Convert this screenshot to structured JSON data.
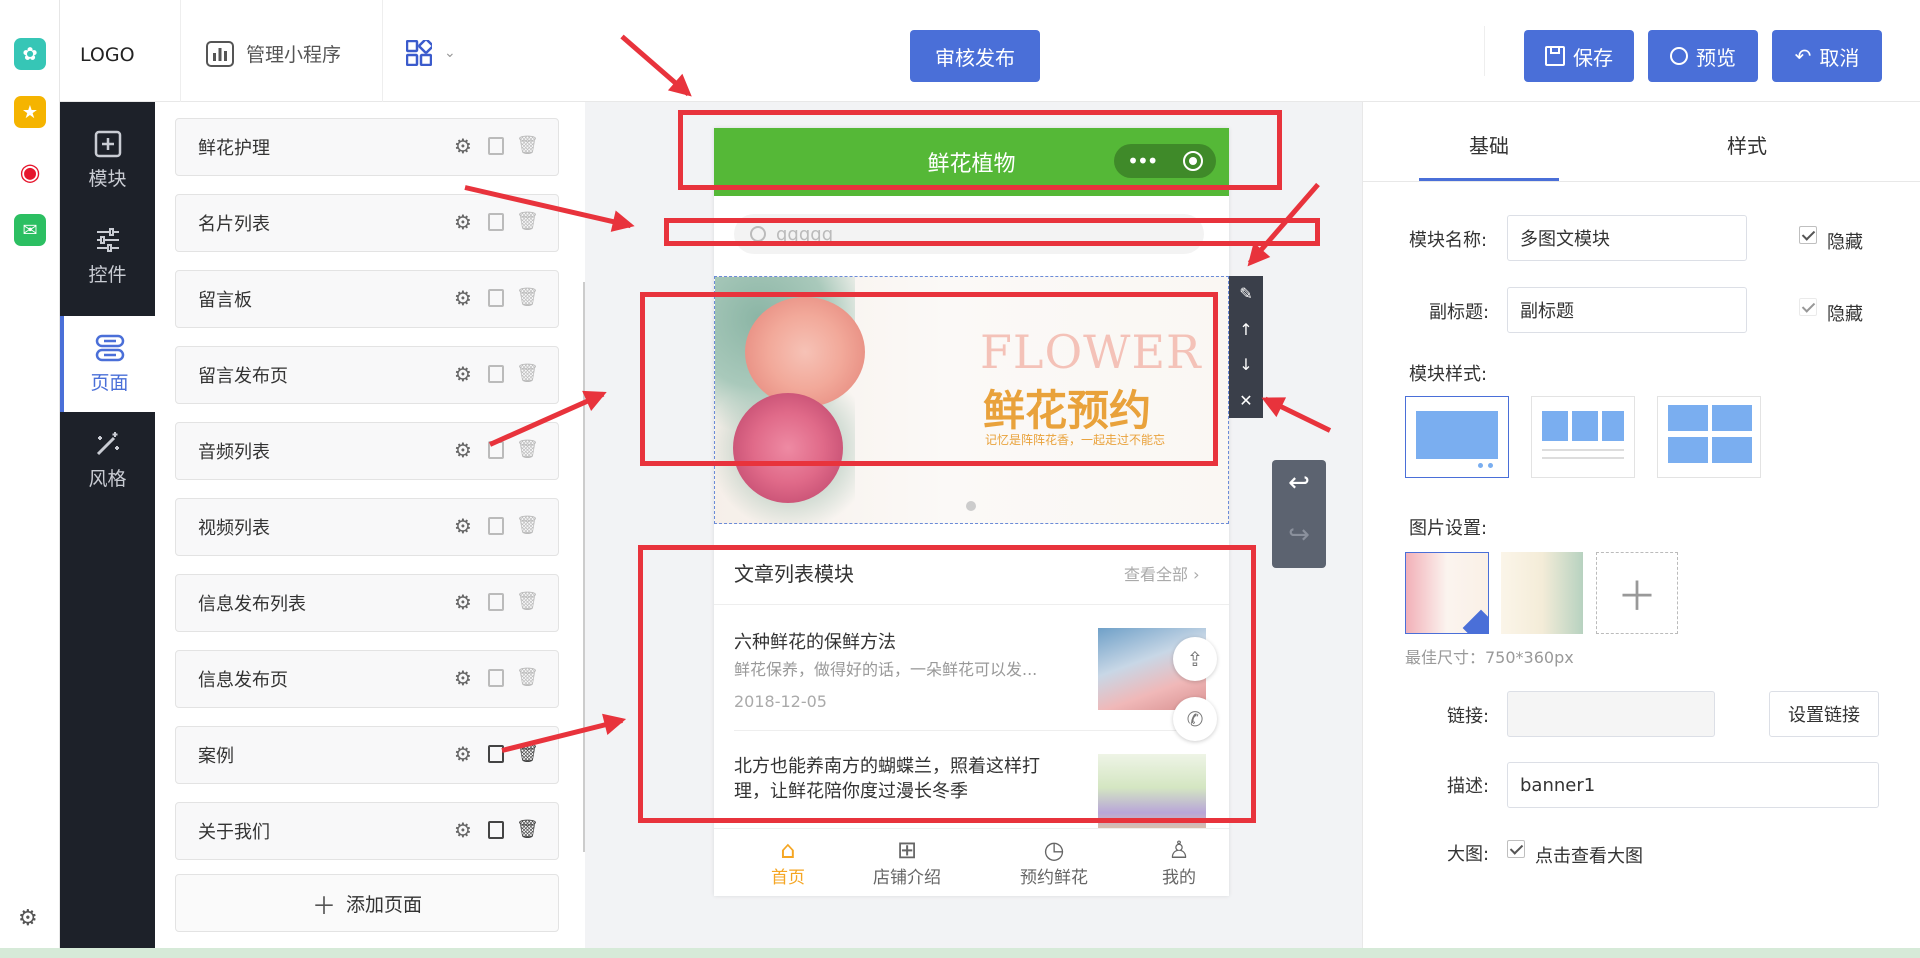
{
  "topbar": {
    "logo": "LOGO",
    "manage_label": "管理小程序",
    "publish_label": "审核发布",
    "save_label": "保存",
    "preview_label": "预览",
    "cancel_label": "取消"
  },
  "nav": [
    {
      "label": "模块",
      "icon": "plus-square-icon"
    },
    {
      "label": "控件",
      "icon": "sliders-icon"
    },
    {
      "label": "页面",
      "icon": "pages-icon"
    },
    {
      "label": "风格",
      "icon": "magic-wand-icon"
    }
  ],
  "pages": [
    "鲜花护理",
    "名片列表",
    "留言板",
    "留言发布页",
    "音频列表",
    "视频列表",
    "信息发布列表",
    "信息发布页",
    "案例",
    "关于我们"
  ],
  "add_page_label": "添加页面",
  "phone": {
    "title": "鲜花植物",
    "search_placeholder": "qqqqq",
    "banner": {
      "title_en": "FLOWER",
      "title_cn": "鲜花预约",
      "slogan": "记忆是阵阵花香，一起走过不能忘"
    },
    "article_module": {
      "title": "文章列表模块",
      "view_all": "查看全部",
      "articles": [
        {
          "title": "六种鲜花的保鲜方法",
          "summary": "鲜花保养，做得好的话，一朵鲜花可以发...",
          "date": "2018-12-05"
        },
        {
          "title": "北方也能养南方的蝴蝶兰，照着这样打理，让鲜花陪你度过漫长冬季",
          "summary": "",
          "date": ""
        }
      ]
    },
    "tabs": [
      {
        "label": "首页",
        "icon": "home-icon"
      },
      {
        "label": "店铺介绍",
        "icon": "grid-icon"
      },
      {
        "label": "预约鲜花",
        "icon": "clock-icon"
      },
      {
        "label": "我的",
        "icon": "user-icon"
      }
    ]
  },
  "right_panel": {
    "tabs": [
      "基础",
      "样式"
    ],
    "module_name_label": "模块名称:",
    "module_name_value": "多图文模块",
    "hide_label": "隐藏",
    "subtitle_label": "副标题:",
    "subtitle_value": "副标题",
    "hide_label_2": "隐藏",
    "module_style_label": "模块样式:",
    "image_setting_label": "图片设置:",
    "best_size": "最佳尺寸：750*360px",
    "link_label": "链接:",
    "set_link_label": "设置链接",
    "desc_label": "描述:",
    "desc_value": "banner1",
    "big_image_label": "大图:",
    "big_image_check_label": "点击查看大图"
  },
  "colors": {
    "primary": "#4a6fd8",
    "phone_header": "#55b837",
    "annotation_red": "#e8333c",
    "tab_active": "#f5a623"
  }
}
